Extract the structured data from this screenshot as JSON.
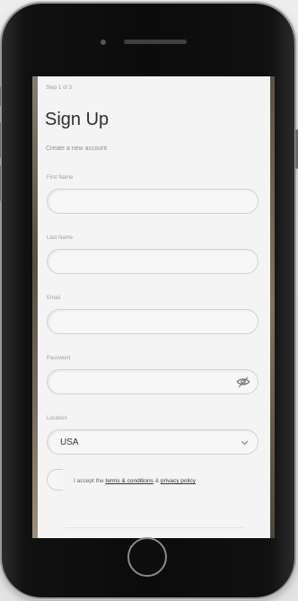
{
  "form": {
    "step": "Step 1 of 3",
    "title": "Sign Up",
    "subtitle": "Create a new account",
    "fields": [
      {
        "label": "First Name",
        "value": ""
      },
      {
        "label": "Last Name",
        "value": ""
      },
      {
        "label": "Email",
        "value": ""
      },
      {
        "label": "Password",
        "value": "",
        "icon": "eye-toggle-icon"
      },
      {
        "label": "Location",
        "value": "USA",
        "icon": "chevron-down-icon"
      }
    ],
    "terms": {
      "prefix": "I accept the",
      "terms_link": "terms & conditions",
      "joiner": "&",
      "privacy_link": "privacy policy"
    }
  }
}
